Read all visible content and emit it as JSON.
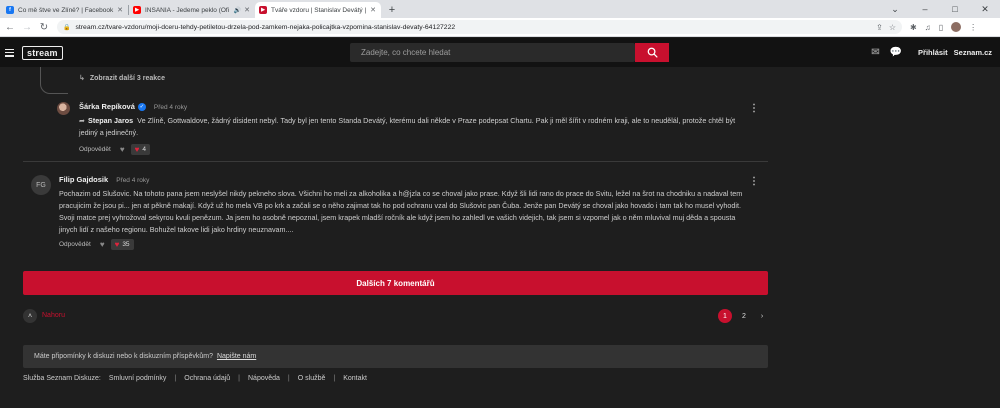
{
  "browser": {
    "tabs": [
      {
        "title": "Co mě štve ve Zlíně? | Facebook",
        "favicon_color": "#1877f2",
        "favicon_glyph": "f",
        "active": false,
        "audio": false
      },
      {
        "title": "INSANIA - Jedeme peklo (Ofi",
        "favicon_color": "#ff0000",
        "favicon_glyph": "▶",
        "active": false,
        "audio": true
      },
      {
        "title": "Tváře vzdoru | Stanislav Devátý |",
        "favicon_color": "#c8102e",
        "favicon_glyph": "▶",
        "active": true,
        "audio": false
      }
    ],
    "new_tab": "+",
    "url": "stream.cz/tvare-vzdoru/moji-dceru-tehdy-petiletou-drzela-pod-zamkem-nejaka-policajtka-vzpominа-stanislav-devaty-64127222"
  },
  "header": {
    "logo": "stream",
    "search_placeholder": "Zadejte, co chcete hledat",
    "login": "Přihlásit",
    "brand_link": "Seznam.cz"
  },
  "replies_link": "Zobrazit další 3 reakce",
  "comments": [
    {
      "author": "Šárka Repíková",
      "verified": true,
      "time": "Před 4 roky",
      "reply_to": "Stepan Jaros",
      "text": "Ve Zlíně, Gottwaldove, žádný disident nebyl. Tady byl jen tento Standa Devátý, kterému dali někde v Praze podepsat Chartu. Pak ji měl šířit v rodném kraji, ale to neudělál, protože chtěl být jediný a jedinečný.",
      "reply_label": "Odpovědět",
      "likes": "4"
    },
    {
      "author": "Filip Gajdosik",
      "initials": "FG",
      "time": "Před 4 roky",
      "text": "Pochazim od Slušovic. Na tohoto pana jsem neslyšel nikdy pekneho slova. Všichni ho meli za alkoholika a h@jzla co se choval jako prase. Když šli lidi rano do prace do Svitu, ležel na šrot na chodniku a nadaval tem pracujicim že jsou pi... jen at pěkně makají. Když už ho mela VB po krk a začali se o něho zajimat tak ho pod ochranu vzal do Slušovic pan Čuba. Jenže pan Devátý se choval jako hovado i tam tak ho musel vyhodit. Svoji matce prej vyhrožoval sekyrou kvuli penězum. Ja jsem ho osobně nepoznal, jsem krapek mladší ročník ale když jsem ho zahledl ve vašich videjich, tak jsem si vzpomel jak o něm mluvival muj děda a spousta jinych lidí z našeho regionu. Bohužel takove lidi jako hrdiny neuznavam....",
      "reply_label": "Odpovědět",
      "likes": "35"
    }
  ],
  "more_comments": "Dalších 7 komentářů",
  "pager": {
    "up_label": "Nahoru",
    "pages": [
      "1",
      "2"
    ],
    "current": "1",
    "next": "›"
  },
  "feedback": {
    "text": "Máte připomínky k diskuzi nebo k diskuzním příspěvkům?",
    "link": "Napište nám"
  },
  "footer": {
    "label": "Služba Seznam Diskuze:",
    "links": [
      "Smluvní podmínky",
      "Ochrana údajů",
      "Nápověda",
      "O službě",
      "Kontakt"
    ]
  },
  "colors": {
    "accent": "#c8102e",
    "background": "#1e1e1e",
    "header": "#121212"
  }
}
